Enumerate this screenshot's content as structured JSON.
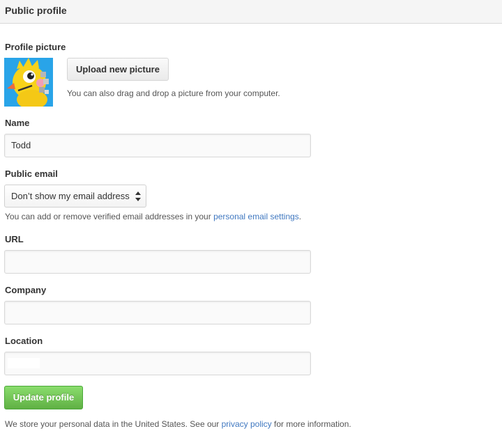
{
  "header": {
    "title": "Public profile"
  },
  "profile_picture": {
    "label": "Profile picture",
    "avatar_icon": "avatar-image",
    "upload_label": "Upload new picture",
    "hint": "You can also drag and drop a picture from your computer."
  },
  "name": {
    "label": "Name",
    "value": "Todd"
  },
  "public_email": {
    "label": "Public email",
    "selected": "Don’t show my email address",
    "hint_prefix": "You can add or remove verified email addresses in your ",
    "hint_link": "personal email settings",
    "hint_suffix": "."
  },
  "url": {
    "label": "URL",
    "value": ""
  },
  "company": {
    "label": "Company",
    "value": ""
  },
  "location": {
    "label": "Location",
    "value": ""
  },
  "actions": {
    "update_label": "Update profile"
  },
  "footer": {
    "prefix": "We store your personal data in the United States. See our ",
    "link": "privacy policy",
    "suffix": " for more information."
  },
  "colors": {
    "link": "#4078c0",
    "primary_button": "#60b044",
    "avatar_background": "#29a4e8"
  }
}
